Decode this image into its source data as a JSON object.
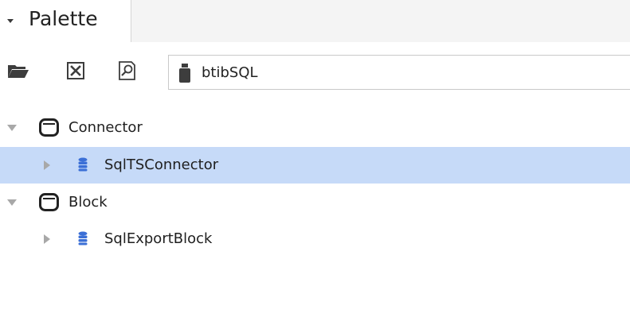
{
  "panel": {
    "title": "Palette",
    "collapse_icon": "triangle-down-icon"
  },
  "toolbar": {
    "open_icon": "folder-open-icon",
    "close_icon": "close-box-icon",
    "find_icon": "find-icon",
    "module_icon": "jar-icon",
    "module_value": "btibSQL"
  },
  "tree": {
    "items": [
      {
        "label": "Connector",
        "kind": "folder",
        "expanded": true,
        "selected": false,
        "icon": "folder-icon"
      },
      {
        "label": "SqlTSConnector",
        "kind": "component",
        "expanded": false,
        "selected": true,
        "icon": "database-icon"
      },
      {
        "label": "Block",
        "kind": "folder",
        "expanded": true,
        "selected": false,
        "icon": "folder-icon"
      },
      {
        "label": "SqlExportBlock",
        "kind": "component",
        "expanded": false,
        "selected": false,
        "icon": "database-icon"
      }
    ]
  },
  "colors": {
    "selection": "#c6daf8",
    "database_icon": "#3b6fd6",
    "expander": "#a8a8a8"
  }
}
